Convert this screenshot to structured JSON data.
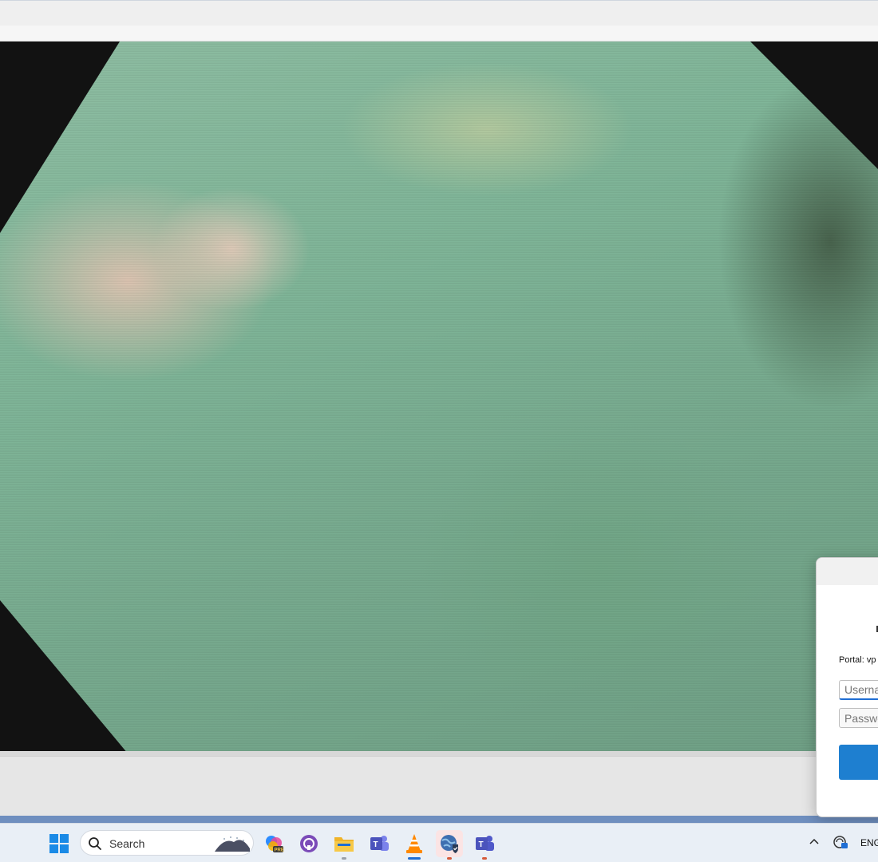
{
  "window": {
    "title": ""
  },
  "vpn_dialog": {
    "portal_label": "Portal: vp",
    "username_placeholder": "Userna",
    "password_placeholder": "Passwo",
    "accent_color": "#1e7fd0"
  },
  "taskbar": {
    "search_label": "Search",
    "apps": [
      {
        "name": "copilot-pre-icon",
        "state": "none"
      },
      {
        "name": "github-desktop-icon",
        "state": "none"
      },
      {
        "name": "file-explorer-icon",
        "state": "running"
      },
      {
        "name": "teams-classic-icon",
        "state": "none"
      },
      {
        "name": "vlc-icon",
        "state": "focused"
      },
      {
        "name": "vpn-client-icon",
        "state": "attention"
      },
      {
        "name": "teams-icon",
        "state": "attention"
      }
    ],
    "tray": {
      "language": "ENG"
    }
  }
}
